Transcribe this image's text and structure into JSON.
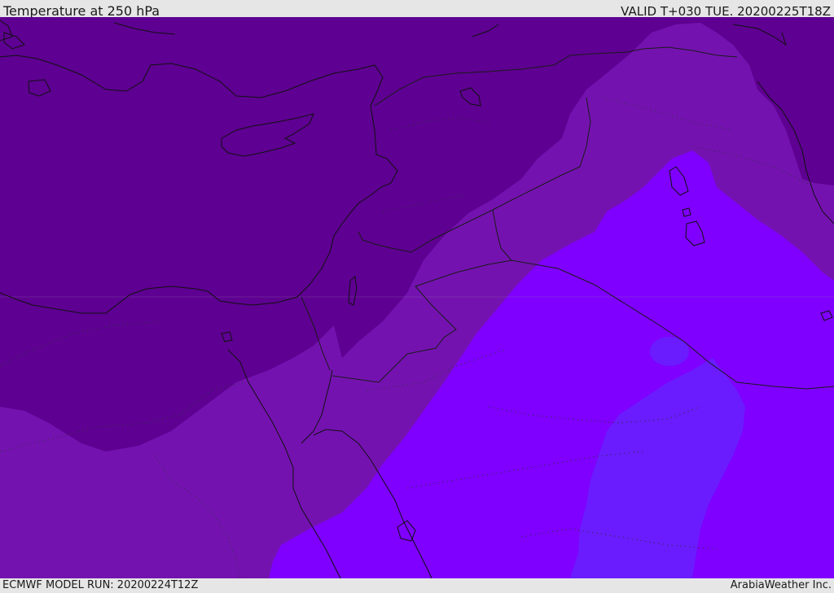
{
  "header": {
    "title": "Temperature at 250 hPa",
    "valid": "VALID T+030 TUE. 20200225T18Z"
  },
  "footer": {
    "model_run": "ECMWF MODEL RUN: 20200224T12Z",
    "provider": "ArabiaWeather Inc."
  },
  "map": {
    "colors": {
      "band_coldest": "#5e0091",
      "band_cold": "#7412b0",
      "band_cool": "#7f00ff",
      "band_mild": "#6a1cff",
      "coastline": "#111111",
      "borders": "#1a1a1a",
      "dotted_boundaries": "#3c2a5a"
    }
  }
}
